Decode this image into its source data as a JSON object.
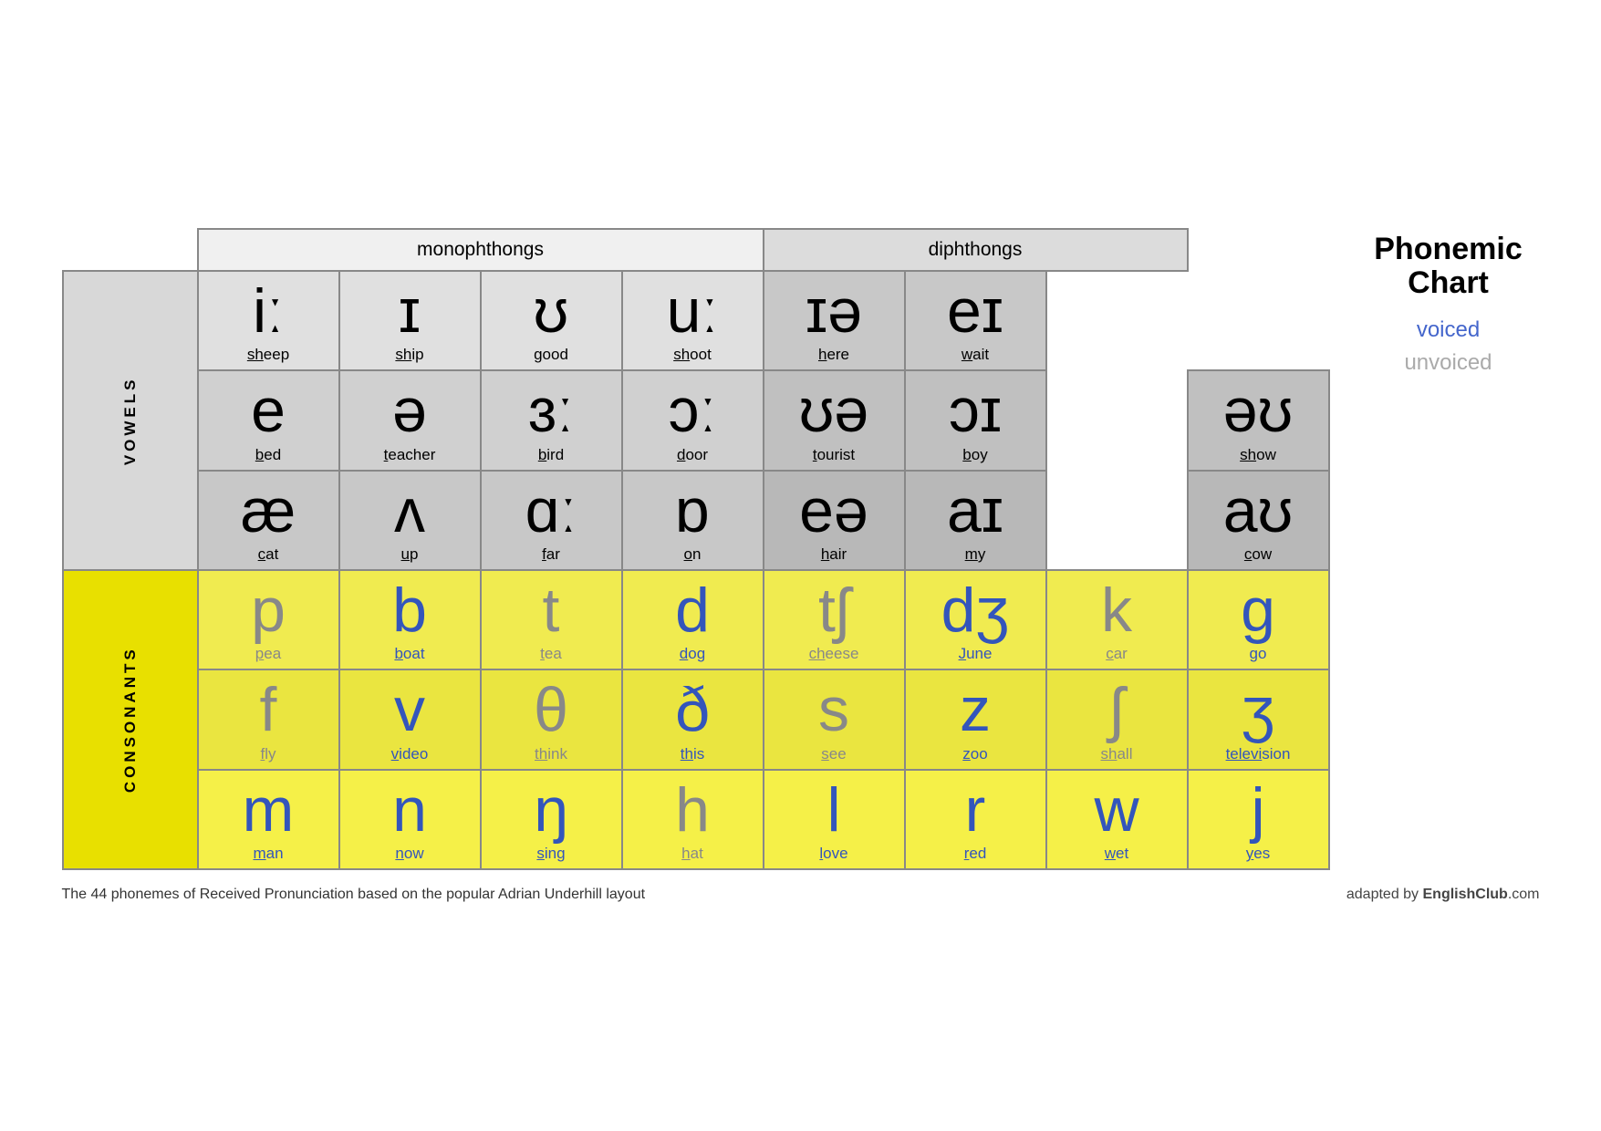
{
  "title": "Phonemic Chart",
  "legend": {
    "title": "Phonemic\nChart",
    "voiced_label": "voiced",
    "unvoiced_label": "unvoiced"
  },
  "headers": {
    "monophthongs": "monophthongs",
    "diphthongs": "diphthongs"
  },
  "side_labels": {
    "vowels": "VOWELS",
    "consonants": "CONSONANTS"
  },
  "vowel_rows": [
    [
      {
        "symbol": "iː",
        "word": "sheep",
        "u": "sh",
        "voiced": true
      },
      {
        "symbol": "ɪ",
        "word": "ship",
        "u": "sh",
        "voiced": true
      },
      {
        "symbol": "ʊ",
        "word": "good",
        "u": "g",
        "voiced": true
      },
      {
        "symbol": "uː",
        "word": "shoot",
        "u": "sh",
        "voiced": true
      },
      {
        "symbol": "ɪə",
        "word": "here",
        "u": "h",
        "voiced": true
      },
      {
        "symbol": "eɪ",
        "word": "wait",
        "u": "w",
        "voiced": true
      }
    ],
    [
      {
        "symbol": "e",
        "word": "bed",
        "u": "b",
        "voiced": true
      },
      {
        "symbol": "ə",
        "word": "teacher",
        "u": "t",
        "voiced": true
      },
      {
        "symbol": "ɜː",
        "word": "bird",
        "u": "b",
        "voiced": true
      },
      {
        "symbol": "ɔː",
        "word": "door",
        "u": "d",
        "voiced": true
      },
      {
        "symbol": "ʊə",
        "word": "tourist",
        "u": "t",
        "voiced": true
      },
      {
        "symbol": "ɔɪ",
        "word": "boy",
        "u": "b",
        "voiced": true
      },
      {
        "symbol": "əʊ",
        "word": "show",
        "u": "sh",
        "voiced": true
      }
    ],
    [
      {
        "symbol": "æ",
        "word": "cat",
        "u": "c",
        "voiced": true
      },
      {
        "symbol": "ʌ",
        "word": "up",
        "u": "u",
        "voiced": true
      },
      {
        "symbol": "ɑː",
        "word": "far",
        "u": "f",
        "voiced": true
      },
      {
        "symbol": "ɒ",
        "word": "on",
        "u": "o",
        "voiced": true
      },
      {
        "symbol": "eə",
        "word": "hair",
        "u": "h",
        "voiced": true
      },
      {
        "symbol": "aɪ",
        "word": "my",
        "u": "m",
        "voiced": true
      },
      {
        "symbol": "aʊ",
        "word": "cow",
        "u": "c",
        "voiced": true
      }
    ]
  ],
  "consonant_rows": [
    [
      {
        "symbol": "p",
        "word": "pea",
        "u": "p",
        "voiced": false
      },
      {
        "symbol": "b",
        "word": "boat",
        "u": "b",
        "voiced": true
      },
      {
        "symbol": "t",
        "word": "tea",
        "u": "t",
        "voiced": false
      },
      {
        "symbol": "d",
        "word": "dog",
        "u": "d",
        "voiced": true
      },
      {
        "symbol": "tʃ",
        "word": "cheese",
        "u": "ch",
        "voiced": false
      },
      {
        "symbol": "dʒ",
        "word": "June",
        "u": "J",
        "voiced": true
      },
      {
        "symbol": "k",
        "word": "car",
        "u": "c",
        "voiced": false
      },
      {
        "symbol": "g",
        "word": "go",
        "u": "g",
        "voiced": true
      }
    ],
    [
      {
        "symbol": "f",
        "word": "fly",
        "u": "f",
        "voiced": false
      },
      {
        "symbol": "v",
        "word": "video",
        "u": "v",
        "voiced": true
      },
      {
        "symbol": "θ",
        "word": "think",
        "u": "th",
        "voiced": false
      },
      {
        "symbol": "ð",
        "word": "this",
        "u": "th",
        "voiced": true
      },
      {
        "symbol": "s",
        "word": "see",
        "u": "s",
        "voiced": false
      },
      {
        "symbol": "z",
        "word": "zoo",
        "u": "z",
        "voiced": true
      },
      {
        "symbol": "ʃ",
        "word": "shall",
        "u": "sh",
        "voiced": false
      },
      {
        "symbol": "ʒ",
        "word": "television",
        "u": "televi",
        "voiced": true
      }
    ],
    [
      {
        "symbol": "m",
        "word": "man",
        "u": "m",
        "voiced": true
      },
      {
        "symbol": "n",
        "word": "now",
        "u": "n",
        "voiced": true
      },
      {
        "symbol": "ŋ",
        "word": "sing",
        "u": "s",
        "voiced": true
      },
      {
        "symbol": "h",
        "word": "hat",
        "u": "h",
        "voiced": false
      },
      {
        "symbol": "l",
        "word": "love",
        "u": "l",
        "voiced": true
      },
      {
        "symbol": "r",
        "word": "red",
        "u": "r",
        "voiced": true
      },
      {
        "symbol": "w",
        "word": "wet",
        "u": "w",
        "voiced": true
      },
      {
        "symbol": "j",
        "word": "yes",
        "u": "y",
        "voiced": true
      }
    ]
  ],
  "footer": {
    "note": "The 44 phonemes of Received Pronunciation based on the popular Adrian Underhill layout",
    "credit_prefix": "adapted by ",
    "credit_brand": "EnglishClub",
    "credit_suffix": ".com"
  }
}
